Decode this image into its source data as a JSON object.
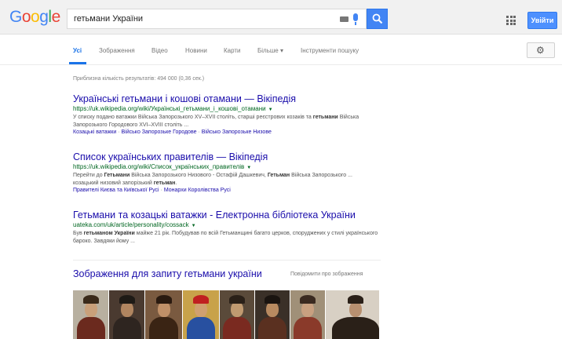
{
  "header": {
    "logo_letters": [
      {
        "ch": "G",
        "cls": "b"
      },
      {
        "ch": "o",
        "cls": "r"
      },
      {
        "ch": "o",
        "cls": "y"
      },
      {
        "ch": "g",
        "cls": "b"
      },
      {
        "ch": "l",
        "cls": "g"
      },
      {
        "ch": "e",
        "cls": "r"
      }
    ],
    "search_value": "гетьмани України",
    "signin_label": "Увійти",
    "icons": [
      "keyboard-icon",
      "mic-icon",
      "search-icon",
      "apps-icon"
    ]
  },
  "tabs": [
    "Усі",
    "Зображення",
    "Відео",
    "Новини",
    "Карти",
    "Більше ▾",
    "Інструменти пошуку"
  ],
  "active_tab": 0,
  "stats": "Приблизна кількість результатів: 494 000 (0,36 сек.)",
  "results": [
    {
      "title": "Українські гетьмани і кошові отамани — Вікіпедія",
      "url": "https://uk.wikipedia.org/wiki/Українські_гетьмани_і_кошові_отамани",
      "snippet_html": "У списку подано ватажки Війська Запорозького XV–XVII століть, старші реєстрових козаків та <b>гетьмани</b> Війська Запорозького Городового XVI–XVIII століть ...",
      "links": [
        "Козацькі ватажки",
        "Військо Запорозьке Городове",
        "Військо Запорозьке Низове"
      ]
    },
    {
      "title": "Список українських правителів — Вікіпедія",
      "url": "https://uk.wikipedia.org/wiki/Список_українських_правителів",
      "snippet_html": "Перейти до <b>Гетьмани</b> Війська Запорозького Низового - Остафій Дашкевич, <b>Гетьман</b> Війська Запорозького ... козацький низовий запорізький <b>гетьман</b>.",
      "links": [
        "Правителі Києва та Київської Русі",
        "Монархи Королівства Русі"
      ]
    },
    {
      "title": "Гетьмани та козацькі ватажки - Електронна бібліотека України",
      "url": "uateka.com/uk/article/personality/cossack",
      "snippet_html": "Був <b>гетьманом України</b> майже 21 рік. Побудував по всій Гетьманщині багато церков, споруджених у стилі українського бароко. Завдяки йому ...",
      "links": []
    }
  ],
  "images_block": {
    "heading": "Зображення для запиту гетьмани україни",
    "report_label": "Повідомити про зображення",
    "thumbs": [
      {
        "bg": "#b8b0a0",
        "coat": "#6b2a1e",
        "face": "#c9a07a",
        "hat": "#3a2a1a"
      },
      {
        "bg": "#4a3a30",
        "coat": "#2e2520",
        "face": "#b08560",
        "hat": "#1e1a16"
      },
      {
        "bg": "#7a5a40",
        "coat": "#3a2414",
        "face": "#c09068",
        "hat": "#2a1a10"
      },
      {
        "bg": "#c8a24a",
        "coat": "#2850a0",
        "face": "#d0a070",
        "hat": "#c02020"
      },
      {
        "bg": "#5a4a3a",
        "coat": "#7a2a20",
        "face": "#c09a70",
        "hat": "#2a2018"
      },
      {
        "bg": "#3a3028",
        "coat": "#5a3020",
        "face": "#b88a60",
        "hat": "#1a1410"
      },
      {
        "bg": "#a09078",
        "coat": "#8a3a2a",
        "face": "#c8a080",
        "hat": "#3a2a20"
      },
      {
        "bg": "#d8d0c4",
        "coat": "#2a2018",
        "face": "#b89070",
        "hat": "#2a2018"
      }
    ]
  }
}
